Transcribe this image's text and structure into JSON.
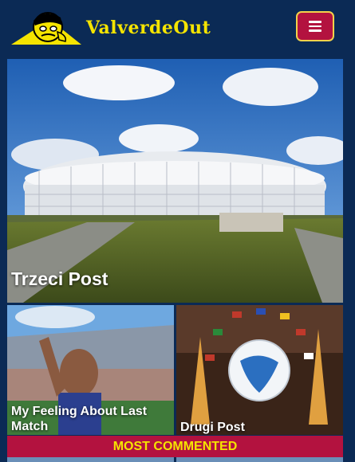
{
  "header": {
    "site_name": "ValverdeOut",
    "logo_icon": "cartoon-face-logo-icon",
    "menu_icon": "hamburger-menu-icon"
  },
  "featured": {
    "title": "Trzeci Post",
    "image": "stadium-photo"
  },
  "cards": [
    {
      "title": "My Feeling About Last Match",
      "image": "fan-in-stadium-photo"
    },
    {
      "title": "Drugi Post",
      "image": "euro-ball-eiffel-tower-photo"
    }
  ],
  "section": {
    "label": "MOST COMMENTED"
  },
  "colors": {
    "background": "#0b2a55",
    "accent": "#b3123f",
    "brand_yellow": "#f5e400"
  }
}
